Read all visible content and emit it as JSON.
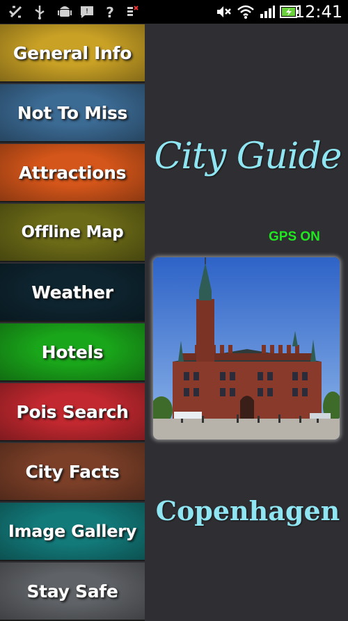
{
  "status_bar": {
    "time": "12:41",
    "left_icons": [
      "usb-debug-icon",
      "usb-icon",
      "android-icon",
      "message-icon",
      "help-icon",
      "battery-alert-icon"
    ],
    "right_icons": [
      "mute-icon",
      "wifi-icon",
      "signal-icon",
      "battery-icon"
    ]
  },
  "menu": {
    "items": [
      {
        "label": "General Info",
        "color": "#c9a125"
      },
      {
        "label": "Not To Miss",
        "color": "#3b6a93"
      },
      {
        "label": "Attractions",
        "color": "#d5561a"
      },
      {
        "label": "Offline Map",
        "color": "#6b6a17"
      },
      {
        "label": "Weather",
        "color": "#0e2530"
      },
      {
        "label": "Hotels",
        "color": "#1aa61a"
      },
      {
        "label": "Pois Search",
        "color": "#c1282f"
      },
      {
        "label": "City Facts",
        "color": "#7b3f28"
      },
      {
        "label": "Image Gallery",
        "color": "#137a7a"
      },
      {
        "label": "Stay Safe",
        "color": "#5f6266"
      }
    ]
  },
  "main": {
    "title": "City Guide",
    "gps_status": "GPS ON",
    "city": "Copenhagen"
  }
}
